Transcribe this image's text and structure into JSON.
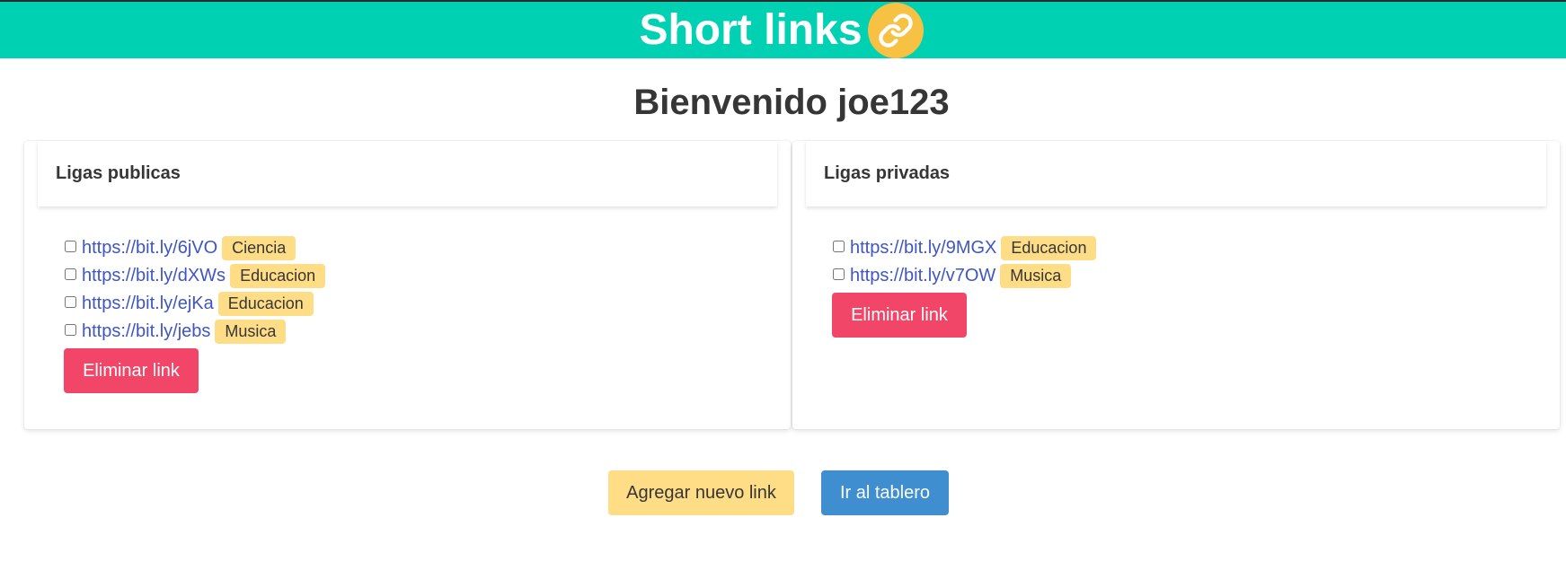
{
  "header": {
    "title": "Short links",
    "icon": "link-icon",
    "bg_color": "#00d1b2",
    "icon_bg": "#f7c243"
  },
  "welcome": "Bienvenido joe123",
  "public_panel": {
    "title": "Ligas publicas",
    "links": [
      {
        "url": "https://bit.ly/6jVO",
        "tag": "Ciencia"
      },
      {
        "url": "https://bit.ly/dXWs",
        "tag": "Educacion"
      },
      {
        "url": "https://bit.ly/ejKa",
        "tag": "Educacion"
      },
      {
        "url": "https://bit.ly/jebs",
        "tag": "Musica"
      }
    ],
    "delete_label": "Eliminar link"
  },
  "private_panel": {
    "title": "Ligas privadas",
    "links": [
      {
        "url": "https://bit.ly/9MGX",
        "tag": "Educacion"
      },
      {
        "url": "https://bit.ly/v7OW",
        "tag": "Musica"
      }
    ],
    "delete_label": "Eliminar link"
  },
  "actions": {
    "add_label": "Agregar nuevo link",
    "dashboard_label": "Ir al tablero"
  },
  "colors": {
    "danger": "#f14668",
    "warning": "#ffdd87",
    "info": "#3e8ed0",
    "link": "#3e56c4"
  }
}
